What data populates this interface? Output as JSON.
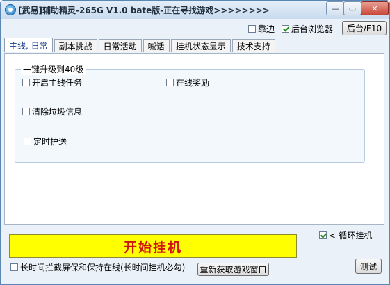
{
  "window": {
    "title": "[武易]辅助精灵-265G V1.0 bate版-正在寻找游戏>>>>>>>>",
    "min_label": "—",
    "max_label": "▭",
    "close_label": "✕"
  },
  "top_options": {
    "corner_label": "靠边",
    "corner_checked": false,
    "background_browser_label": "后台浏览器",
    "background_browser_checked": true,
    "background_button": "后台/F10"
  },
  "tabs": [
    {
      "label": "主线, 日常",
      "active": true
    },
    {
      "label": "副本挑战",
      "active": false
    },
    {
      "label": "日常活动",
      "active": false
    },
    {
      "label": "喊话",
      "active": false
    },
    {
      "label": "挂机状态显示",
      "active": false
    },
    {
      "label": "技术支持",
      "active": false
    }
  ],
  "panel": {
    "group_title": "一键升级到40级",
    "options": [
      {
        "label": "开启主线任务",
        "checked": false
      },
      {
        "label": "在线奖励",
        "checked": false
      },
      {
        "label": "清除垃圾信息",
        "checked": false
      },
      {
        "label": "定时护送",
        "checked": false
      }
    ]
  },
  "bottom": {
    "start_button": "开始挂机",
    "loop_label": "<-循环挂机",
    "loop_checked": true,
    "long_block_label": "长时间拦截屏保和保持在线(长时间挂机必勾)",
    "long_block_checked": false,
    "refresh_button": "重新获取游戏窗口",
    "test_button": "测试"
  },
  "colors": {
    "start_bg": "#ffff00",
    "start_text": "#d0150f",
    "accent": "#1c3e8c"
  }
}
